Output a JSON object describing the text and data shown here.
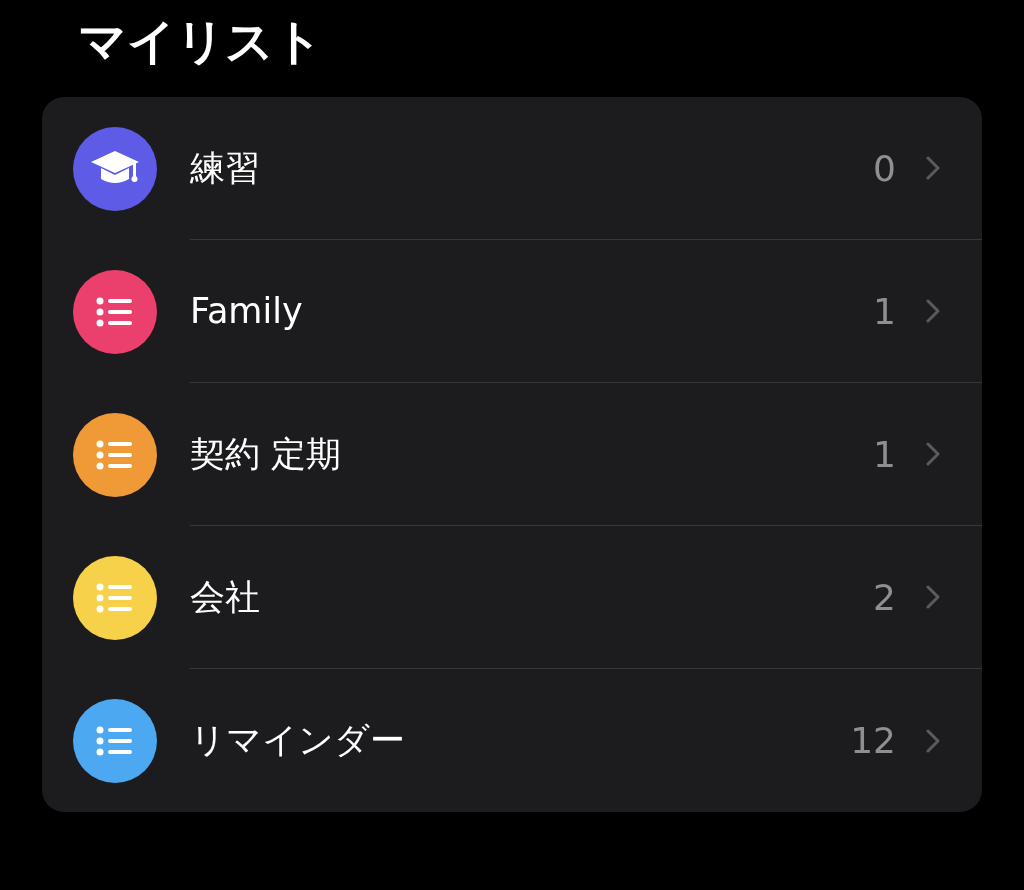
{
  "title": "マイリスト",
  "lists": [
    {
      "name": "練習",
      "count": "0",
      "color": "#5e5ce6",
      "kind": "graduation"
    },
    {
      "name": "Family",
      "count": "1",
      "color": "#eb406d",
      "kind": "list"
    },
    {
      "name": "契約 定期",
      "count": "1",
      "color": "#f09a37",
      "kind": "list"
    },
    {
      "name": "会社",
      "count": "2",
      "color": "#f8d14a",
      "kind": "list"
    },
    {
      "name": "リマインダー",
      "count": "12",
      "color": "#4ca8f1",
      "kind": "list"
    }
  ]
}
